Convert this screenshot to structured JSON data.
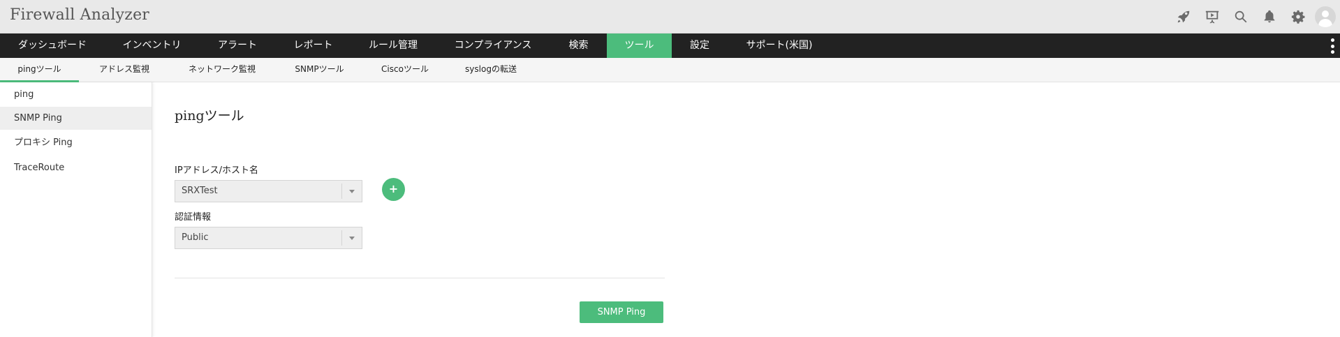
{
  "header": {
    "title": "Firewall Analyzer",
    "icons": [
      "rocket-icon",
      "presentation-icon",
      "search-icon",
      "bell-icon",
      "gear-icon",
      "user-avatar"
    ]
  },
  "mainnav": {
    "items": [
      {
        "label": "ダッシュボード"
      },
      {
        "label": "インベントリ"
      },
      {
        "label": "アラート"
      },
      {
        "label": "レポート"
      },
      {
        "label": "ルール管理"
      },
      {
        "label": "コンプライアンス"
      },
      {
        "label": "検索"
      },
      {
        "label": "ツール"
      },
      {
        "label": "設定"
      },
      {
        "label": "サポート(米国)"
      }
    ],
    "active": "ツール",
    "active_color": "#4cbc7c"
  },
  "subnav": {
    "items": [
      {
        "label": "pingツール"
      },
      {
        "label": "アドレス監視"
      },
      {
        "label": "ネットワーク監視"
      },
      {
        "label": "SNMPツール"
      },
      {
        "label": "Ciscoツール"
      },
      {
        "label": "syslogの転送"
      }
    ],
    "active": "pingツール"
  },
  "sidebar": {
    "items": [
      {
        "label": "ping"
      },
      {
        "label": "SNMP Ping"
      },
      {
        "label": "プロキシ Ping"
      },
      {
        "label": "TraceRoute"
      }
    ],
    "active": "SNMP Ping"
  },
  "main": {
    "title": "pingツール",
    "host_label": "IPアドレス/ホスト名",
    "host_value": "SRXTest",
    "cred_label": "認証情報",
    "cred_value": "Public",
    "add_label": "+",
    "submit_label": "SNMP Ping"
  }
}
